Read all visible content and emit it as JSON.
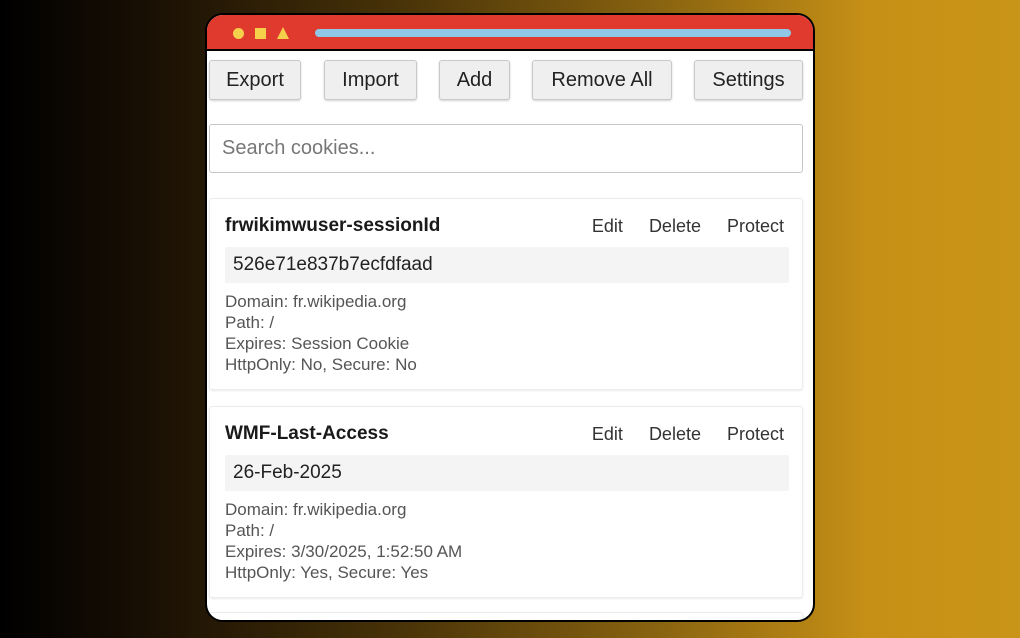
{
  "toolbar": {
    "export_label": "Export",
    "import_label": "Import",
    "add_label": "Add",
    "remove_all_label": "Remove All",
    "settings_label": "Settings"
  },
  "search": {
    "placeholder": "Search cookies..."
  },
  "cookies": [
    {
      "name": "frwikimwuser-sessionId",
      "value": "526e71e837b7ecfdfaad",
      "domain": "Domain: fr.wikipedia.org",
      "path": "Path: /",
      "expires": "Expires: Session Cookie",
      "flags": "HttpOnly: No, Secure: No",
      "edit_label": "Edit",
      "delete_label": "Delete",
      "protect_label": "Protect"
    },
    {
      "name": "WMF-Last-Access",
      "value": "26-Feb-2025",
      "domain": "Domain: fr.wikipedia.org",
      "path": "Path: /",
      "expires": "Expires: 3/30/2025, 1:52:50 AM",
      "flags": "HttpOnly: Yes, Secure: Yes",
      "edit_label": "Edit",
      "delete_label": "Delete",
      "protect_label": "Protect"
    }
  ],
  "colors": {
    "titlebar": "#e03a2f",
    "window_controls": "#f5d04a",
    "address_bar": "#8ec8e6",
    "background_start": "#000000",
    "background_end": "#c99518"
  }
}
